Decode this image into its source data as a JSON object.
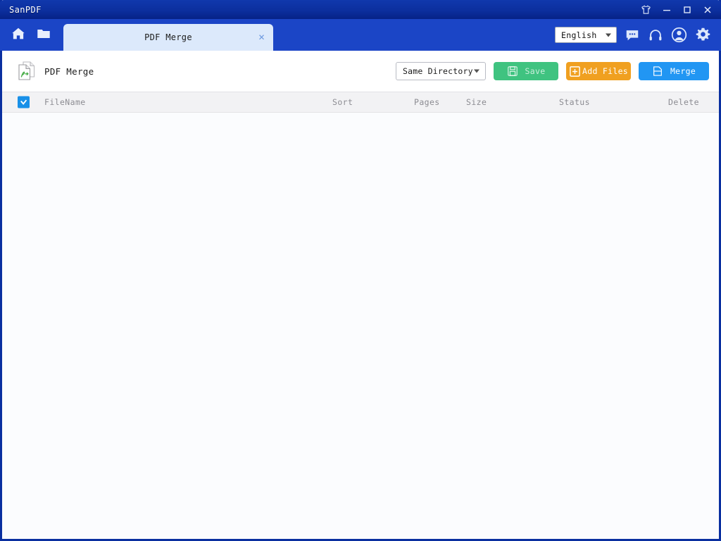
{
  "window": {
    "title": "SanPDF",
    "controls": [
      {
        "name": "skin-icon",
        "label": "skin"
      },
      {
        "name": "minimize-icon",
        "label": "minimize"
      },
      {
        "name": "maximize-icon",
        "label": "maximize"
      },
      {
        "name": "close-icon",
        "label": "close"
      }
    ]
  },
  "navbar": {
    "home_icon": "home-icon",
    "folder_icon": "folder-icon",
    "tab": {
      "label": "PDF Merge",
      "close_label": "×"
    },
    "language": {
      "value": "English",
      "options": [
        "English"
      ]
    },
    "icons": [
      {
        "name": "chat-icon",
        "label": "chat"
      },
      {
        "name": "headset-icon",
        "label": "support"
      },
      {
        "name": "user-icon",
        "label": "account"
      },
      {
        "name": "settings-icon",
        "label": "settings"
      }
    ]
  },
  "page_header": {
    "icon": "pdf-merge-icon",
    "title": "PDF Merge",
    "output_dir": {
      "value": "Same Directory",
      "options": [
        "Same Directory"
      ]
    },
    "save_label": "Save",
    "add_files_label": "Add Files",
    "merge_label": "Merge"
  },
  "table": {
    "select_all_checked": true,
    "columns": {
      "filename": "FileName",
      "sort": "Sort",
      "pages": "Pages",
      "size": "Size",
      "status": "Status",
      "delete": "Delete"
    },
    "rows": []
  },
  "colors": {
    "titlebar": "#0c2f9e",
    "navbar": "#1b45c6",
    "tab_active": "#dce9fb",
    "save_green": "#3fc380",
    "addfiles_orange": "#f0a020",
    "merge_blue": "#2196f3",
    "checkbox_blue": "#1890e8",
    "content_bg": "#fbfcfe"
  }
}
